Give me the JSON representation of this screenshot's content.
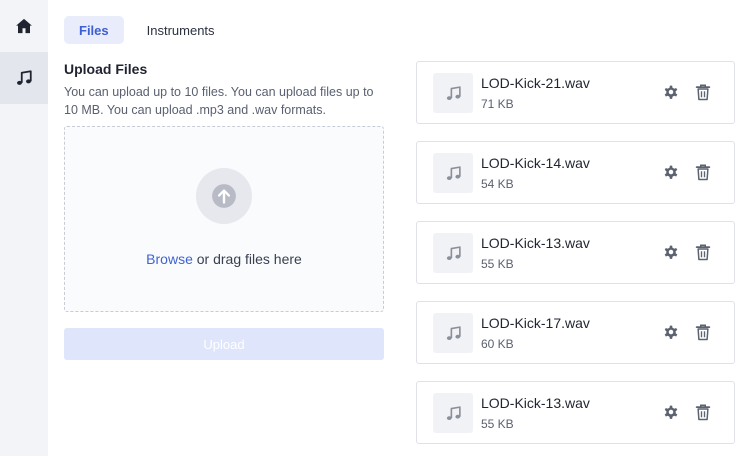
{
  "sidebar": {
    "items": [
      {
        "icon": "home-icon"
      },
      {
        "icon": "music-note-icon"
      }
    ]
  },
  "tabs": [
    {
      "label": "Files",
      "active": true
    },
    {
      "label": "Instruments",
      "active": false
    }
  ],
  "upload": {
    "title": "Upload Files",
    "description": "You can upload up to 10 files. You can upload files up to 10 MB. You can upload .mp3 and .wav formats.",
    "browse_label": "Browse",
    "drop_label": " or drag files here",
    "button_label": "Upload"
  },
  "files": [
    {
      "name": "LOD-Kick-21.wav",
      "size": "71 KB"
    },
    {
      "name": "LOD-Kick-14.wav",
      "size": "54 KB"
    },
    {
      "name": "LOD-Kick-13.wav",
      "size": "55 KB"
    },
    {
      "name": "LOD-Kick-17.wav",
      "size": "60 KB"
    },
    {
      "name": "LOD-Kick-13.wav",
      "size": "55 KB"
    }
  ],
  "colors": {
    "accent": "#3f63d3",
    "tab_active_bg": "#e8ecfb",
    "upload_button_disabled": "#dfe5fb",
    "icon_gray": "#5c6270"
  }
}
